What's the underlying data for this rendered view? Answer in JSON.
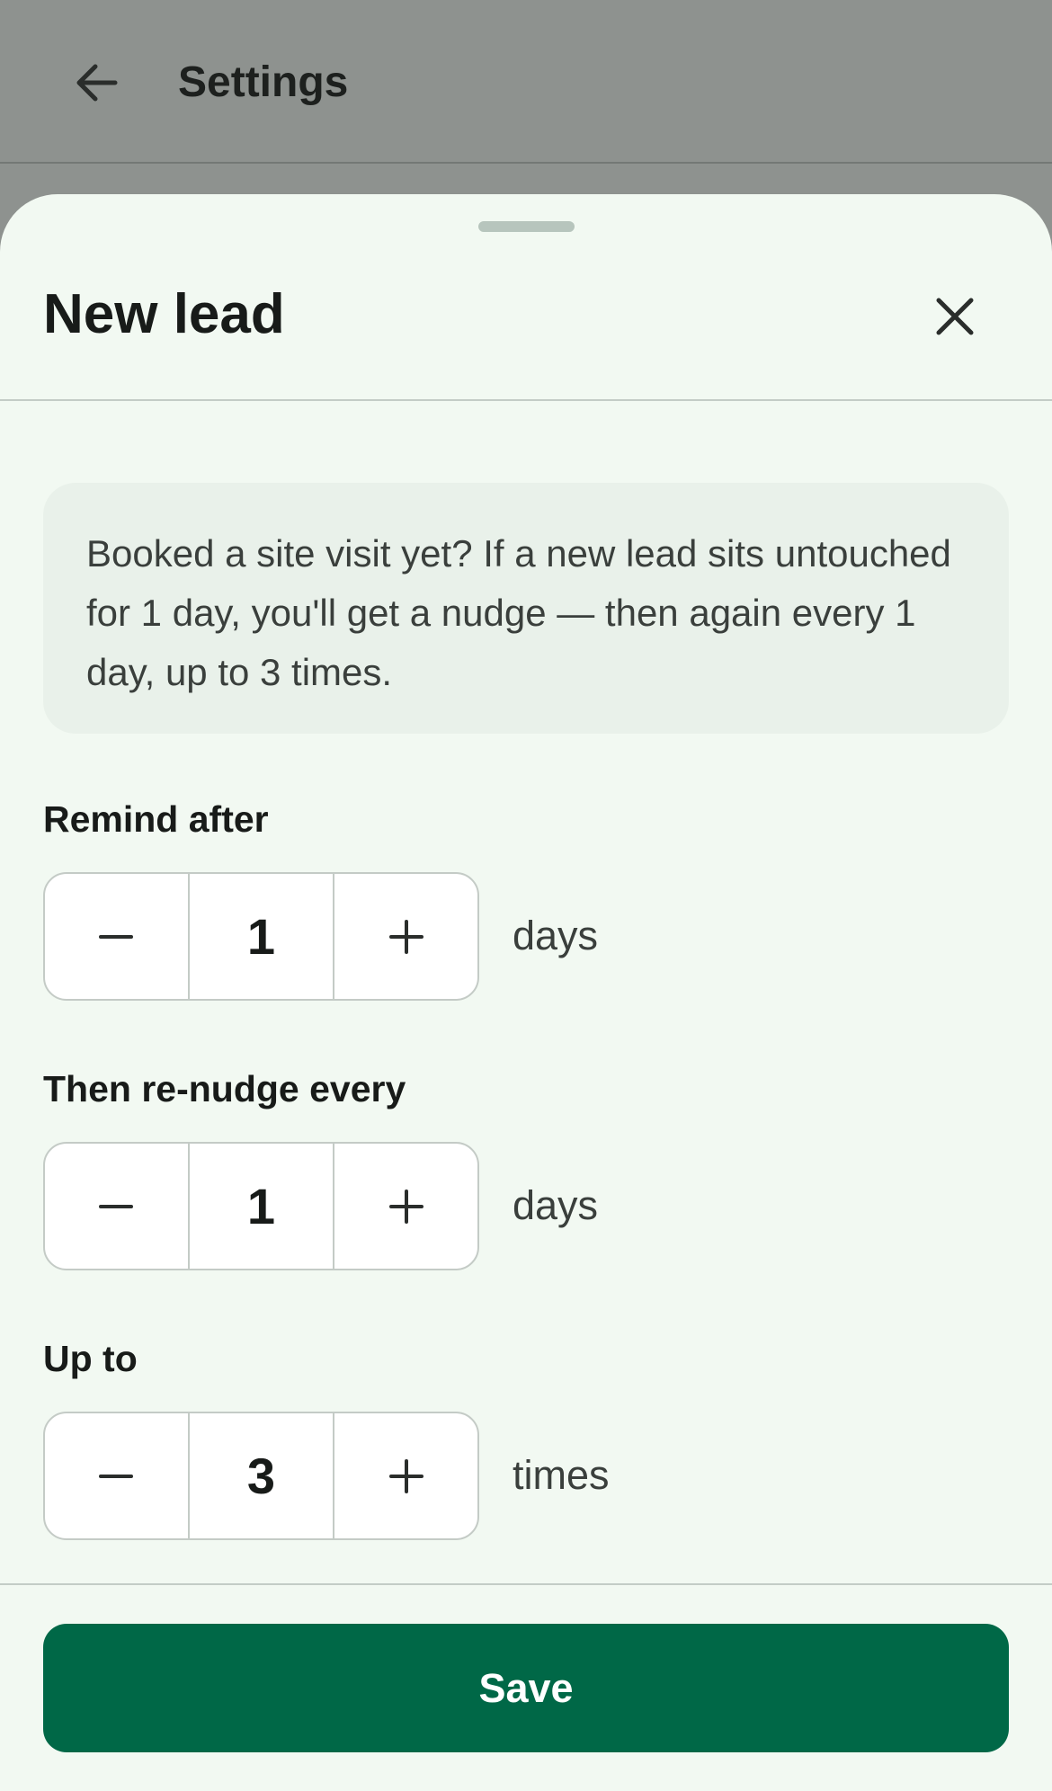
{
  "app_bar": {
    "title": "Settings",
    "back_icon": "arrow-left-icon"
  },
  "sheet": {
    "title": "New lead",
    "close_icon": "close-icon",
    "info_text": "Booked a site visit yet? If a new lead sits untouched for 1 day, you'll get a nudge — then again every 1 day, up to 3 times."
  },
  "fields": [
    {
      "label": "Remind after",
      "value": "1",
      "unit": "days"
    },
    {
      "label": "Then re-nudge every",
      "value": "1",
      "unit": "days"
    },
    {
      "label": "Up to",
      "value": "3",
      "unit": "times"
    }
  ],
  "footer": {
    "save_label": "Save"
  },
  "colors": {
    "primary": "#006847",
    "sheet_background": "#f2f9f2",
    "info_background": "#e9f1ea",
    "scrim": "#8e928f"
  }
}
